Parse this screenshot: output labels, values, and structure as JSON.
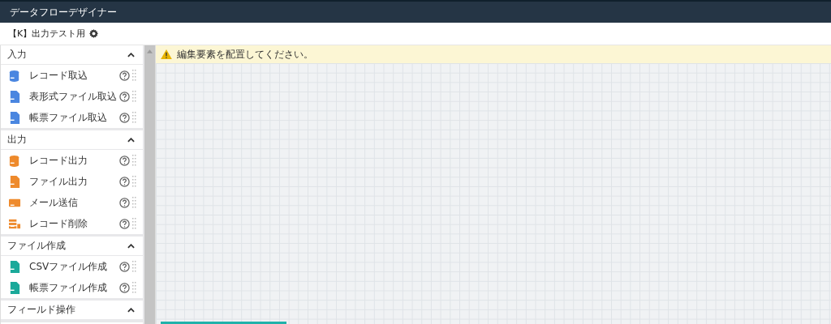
{
  "window": {
    "title": "データフローデザイナー"
  },
  "flow": {
    "name": "【K】出力テスト用"
  },
  "sections": [
    {
      "title": "入力",
      "expanded": true,
      "items": [
        {
          "label": "レコード取込"
        },
        {
          "label": "表形式ファイル取込"
        },
        {
          "label": "帳票ファイル取込"
        }
      ]
    },
    {
      "title": "出力",
      "expanded": true,
      "items": [
        {
          "label": "レコード出力"
        },
        {
          "label": "ファイル出力"
        },
        {
          "label": "メール送信"
        },
        {
          "label": "レコード削除"
        }
      ]
    },
    {
      "title": "ファイル作成",
      "expanded": true,
      "items": [
        {
          "label": "CSVファイル作成"
        },
        {
          "label": "帳票ファイル作成"
        }
      ]
    },
    {
      "title": "フィールド操作",
      "expanded": true
    }
  ],
  "canvas": {
    "warning": "編集要素を配置してください。"
  }
}
